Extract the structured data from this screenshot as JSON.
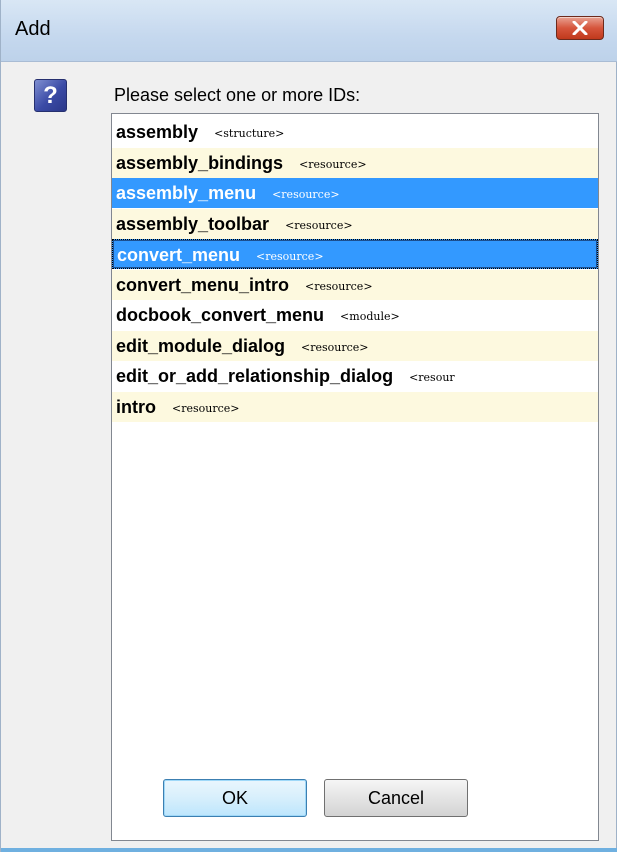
{
  "dialog": {
    "title": "Add",
    "prompt": "Please select one or more IDs:",
    "icon": "question-icon",
    "question_glyph": "?",
    "ok_label": "OK",
    "cancel_label": "Cancel"
  },
  "colors": {
    "selection": "#3399ff",
    "alt_row": "#fdf9df",
    "close_button": "#d6553c"
  },
  "items": [
    {
      "id": "assembly",
      "type": "<structure>",
      "selected": false
    },
    {
      "id": "assembly_bindings",
      "type": "<resource>",
      "selected": false
    },
    {
      "id": "assembly_menu",
      "type": "<resource>",
      "selected": true
    },
    {
      "id": "assembly_toolbar",
      "type": "<resource>",
      "selected": false
    },
    {
      "id": "convert_menu",
      "type": "<resource>",
      "selected": true,
      "focused": true
    },
    {
      "id": "convert_menu_intro",
      "type": "<resource>",
      "selected": false
    },
    {
      "id": "docbook_convert_menu",
      "type": "<module>",
      "selected": false
    },
    {
      "id": "edit_module_dialog",
      "type": "<resource>",
      "selected": false
    },
    {
      "id": "edit_or_add_relationship_dialog",
      "type": "<resour",
      "selected": false
    },
    {
      "id": "intro",
      "type": "<resource>",
      "selected": false
    }
  ]
}
